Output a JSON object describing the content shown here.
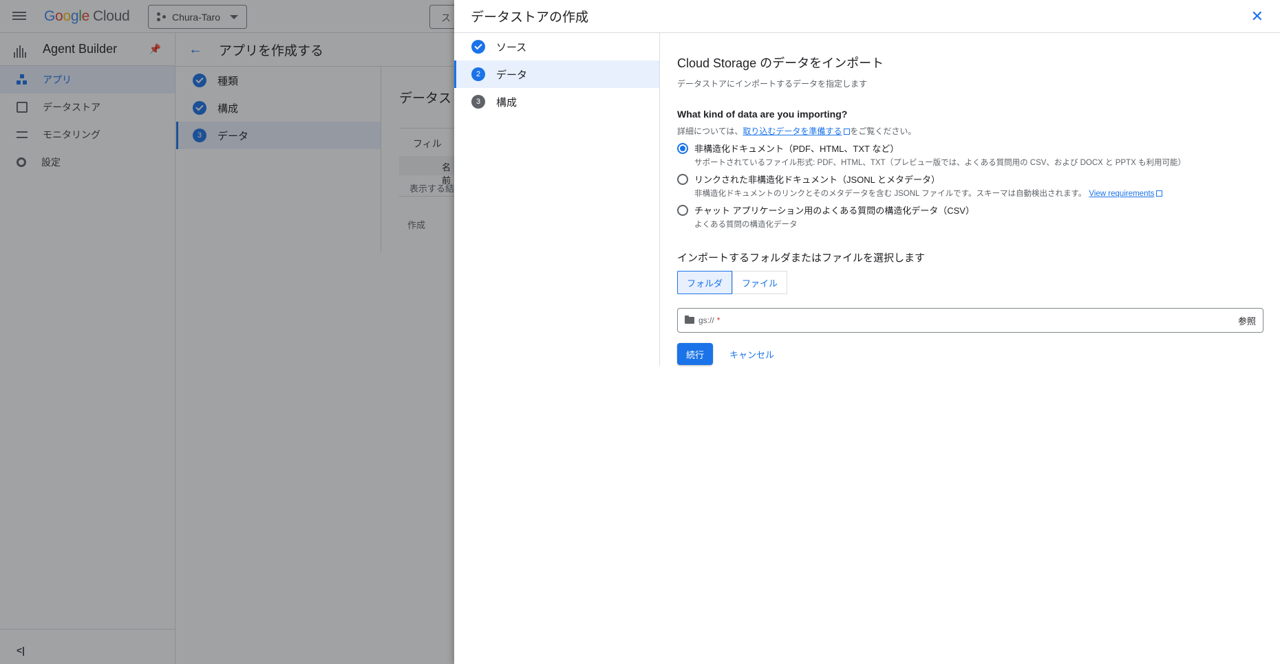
{
  "topbar": {
    "logo_google": "Google",
    "logo_cloud": "Cloud",
    "project": "Chura-Taro",
    "search_stub": "ス"
  },
  "sidenav": {
    "product": "Agent Builder",
    "items": [
      {
        "label": "アプリ",
        "icon": "apps-icon",
        "active": true
      },
      {
        "label": "データストア",
        "icon": "datastore-icon"
      },
      {
        "label": "モニタリング",
        "icon": "monitoring-icon"
      },
      {
        "label": "設定",
        "icon": "settings-icon"
      }
    ],
    "collapse_label": "<|"
  },
  "content": {
    "title": "アプリを作成する",
    "steps": [
      "種類",
      "構成",
      "データ"
    ],
    "active_step_number": "3",
    "main_title_partial": "データスト",
    "filter_partial": "フィル",
    "column_partial": "名前",
    "empty_partial": "表示する結",
    "create_label": "作成"
  },
  "dialog": {
    "title": "データストアの作成",
    "steps": [
      {
        "label": "ソース",
        "state": "done",
        "number": ""
      },
      {
        "label": "データ",
        "state": "current",
        "number": "2"
      },
      {
        "label": "構成",
        "state": "todo",
        "number": "3"
      }
    ],
    "form": {
      "title": "Cloud Storage のデータをインポート",
      "subtitle": "データストアにインポートするデータを指定します",
      "question": "What kind of data are you importing?",
      "help_prefix": "詳細については、",
      "help_link": "取り込むデータを準備する",
      "help_suffix": "をご覧ください。",
      "options": [
        {
          "label": "非構造化ドキュメント（PDF、HTML、TXT など）",
          "desc": "サポートされているファイル形式: PDF、HTML、TXT（プレビュー版では、よくある質問用の CSV、および DOCX と PPTX も利用可能）",
          "checked": true
        },
        {
          "label": "リンクされた非構造化ドキュメント（JSONL とメタデータ）",
          "desc": "非構造化ドキュメントのリンクとそのメタデータを含む JSONL ファイルです。スキーマは自動検出されます。",
          "link": "View requirements",
          "checked": false
        },
        {
          "label": "チャット アプリケーション用のよくある質問の構造化データ（CSV）",
          "desc": "よくある質問の構造化データ",
          "checked": false
        }
      ],
      "pick_title": "インポートするフォルダまたはファイルを選択します",
      "toggle": [
        "フォルダ",
        "ファイル"
      ],
      "path_placeholder": "gs://",
      "required_mark": "*",
      "browse": "参照",
      "continue": "続行",
      "cancel": "キャンセル"
    }
  },
  "colors": {
    "accent": "#1a73e8",
    "scrim": "rgba(32,33,36,0.42)"
  }
}
